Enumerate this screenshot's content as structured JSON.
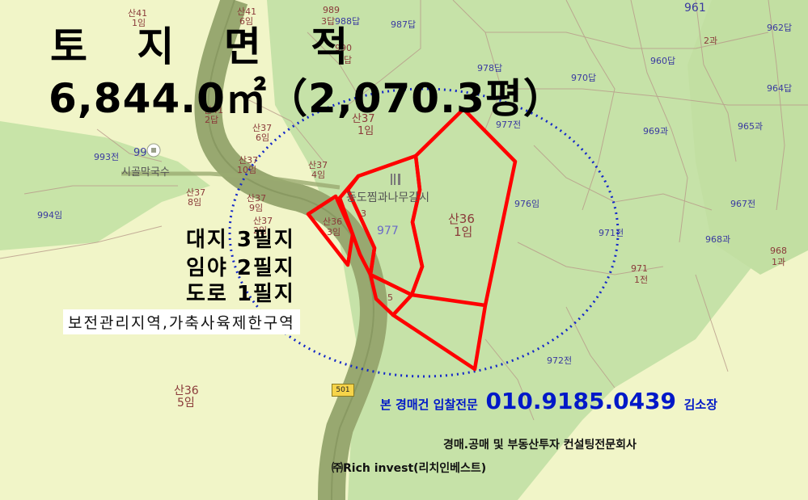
{
  "header": {
    "title": "토 지 면 적",
    "area": "6,844.0㎡（2,070.3평）"
  },
  "counts": {
    "daeji": "대지 3필지",
    "imya": "임야 2필지",
    "doro": "도로 1필지"
  },
  "zone_label": "보전관리지역,가축사육제한구역",
  "contact": {
    "lead": "본 경매건 입찰전문",
    "phone": "010.9185.0439",
    "name": "김소장"
  },
  "company": {
    "line1": "경매.공매 및 부동산투자 컨설팅전문회사",
    "line2": "㈜Rich invest(리치인베스트)"
  },
  "places": {
    "noodle": "시골막국수",
    "restaurant": "동도찜과나무갈시"
  },
  "road_number": "501",
  "parcels": {
    "p1": "산41",
    "p2": "1임",
    "p3": "산41",
    "p4": "6임",
    "p5": "989",
    "p6": "3답",
    "p7": "988답",
    "p8": "987답",
    "p9": "990",
    "p10": "1답",
    "p11": "978답",
    "p12": "970답",
    "p13": "961",
    "p14": "2과",
    "p15": "962답",
    "p16": "960답",
    "p17": "964답",
    "p18": "산37",
    "p19": "1임",
    "p20": "977전",
    "p21": "969과",
    "p22": "965과",
    "p23": "993전",
    "p24": "99",
    "p25": "산37",
    "p26": "6임",
    "p27": "산37",
    "p28": "10임",
    "p29": "산37",
    "p30": "4임",
    "p31": "산37",
    "p32": "8임",
    "p33": "산37",
    "p34": "9임",
    "p35": "산37",
    "p36": "2임",
    "p37": "994임",
    "p38": "산36",
    "p39": "3임",
    "p40": "3",
    "p41": "977",
    "p42": "산36",
    "p43": "1임",
    "p44": "976임",
    "p45": "967전",
    "p46": "971전",
    "p47": "968과",
    "p48": "968",
    "p49": "1과",
    "p50": "971",
    "p51": "1전",
    "p52": "5",
    "p53": "972전",
    "p54": "산36",
    "p55": "5임",
    "p56": "산41",
    "p57": "2답"
  },
  "colors": {
    "forest": "#c6e2a8",
    "field": "#f1f5c8",
    "road": "#98a870",
    "parcel_boundary": "#ff0000",
    "circle": "#1428c8",
    "contact": "#0018c8"
  }
}
